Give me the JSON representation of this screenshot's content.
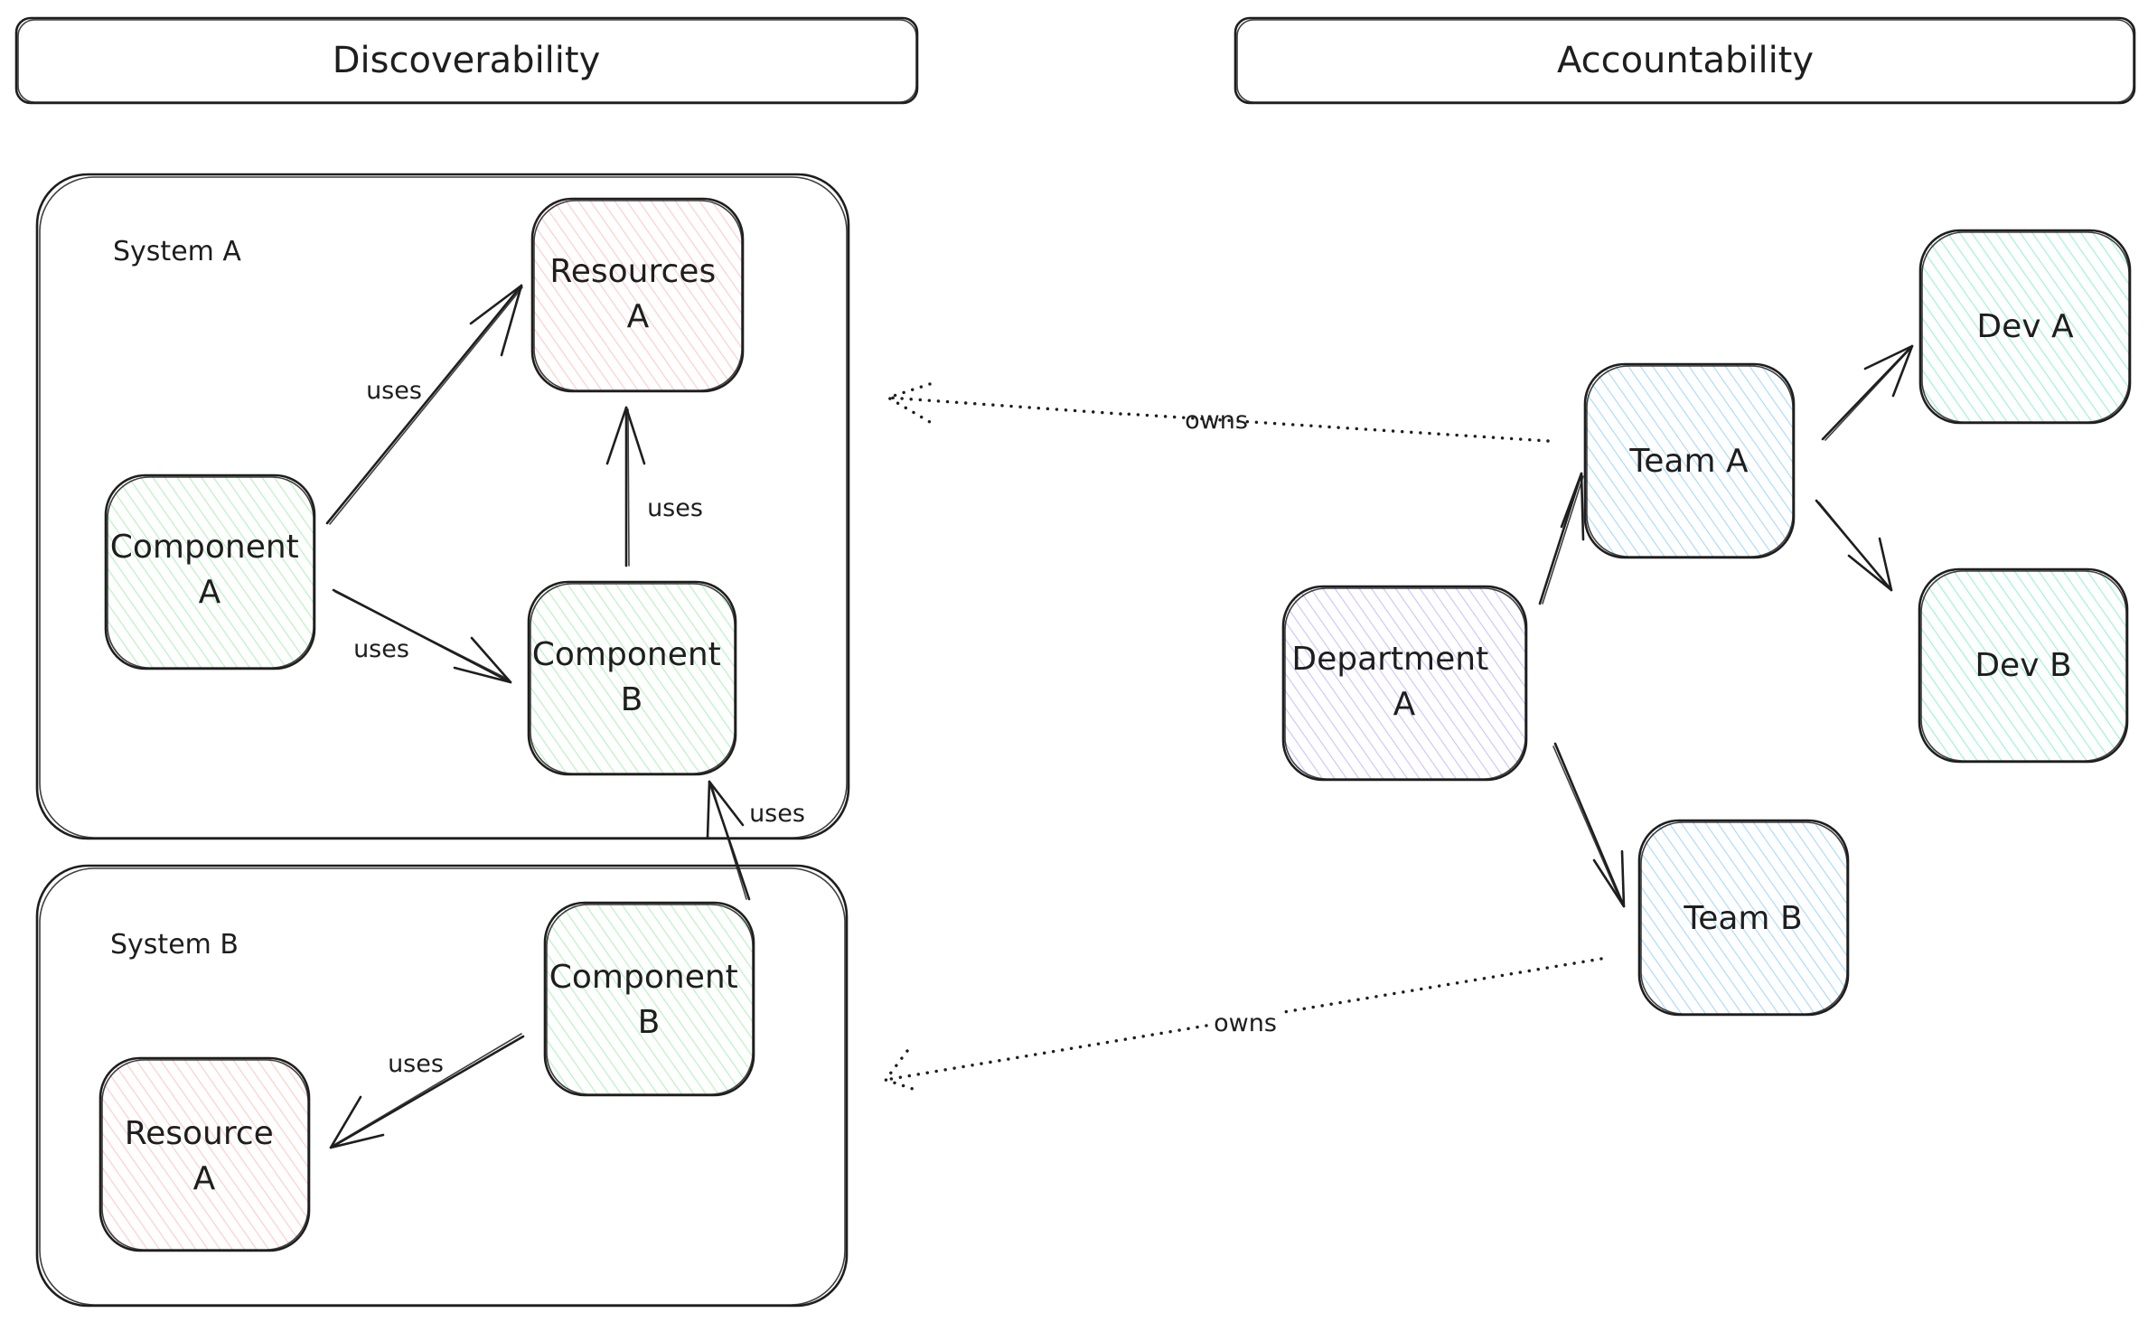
{
  "headers": {
    "left": "Discoverability",
    "right": "Accountability"
  },
  "colors": {
    "stroke": "#1e1e1e",
    "component_fill": "#b2f2bb",
    "resource_fill": "#ffc9c9",
    "department_fill": "#d0bfff",
    "team_fill": "#a5d8ff",
    "dev_fill": "#96f2d7"
  },
  "groups": [
    {
      "id": "system-a",
      "label": "System A"
    },
    {
      "id": "system-b",
      "label": "System B"
    }
  ],
  "nodes": [
    {
      "id": "resources-a",
      "group": "system-a",
      "kind": "resource",
      "lines": [
        "Resources",
        "A"
      ]
    },
    {
      "id": "component-a",
      "group": "system-a",
      "kind": "component",
      "lines": [
        "Component",
        "A"
      ]
    },
    {
      "id": "component-b-sys-a",
      "group": "system-a",
      "kind": "component",
      "lines": [
        "Component",
        "B"
      ]
    },
    {
      "id": "component-b-sys-b",
      "group": "system-b",
      "kind": "component",
      "lines": [
        "Component",
        "B"
      ]
    },
    {
      "id": "resource-a-sys-b",
      "group": "system-b",
      "kind": "resource",
      "lines": [
        "Resource",
        "A"
      ]
    },
    {
      "id": "department-a",
      "kind": "department",
      "lines": [
        "Department",
        "A"
      ]
    },
    {
      "id": "team-a",
      "kind": "team",
      "lines": [
        "Team A"
      ]
    },
    {
      "id": "team-b",
      "kind": "team",
      "lines": [
        "Team B"
      ]
    },
    {
      "id": "dev-a",
      "kind": "dev",
      "lines": [
        "Dev A"
      ]
    },
    {
      "id": "dev-b",
      "kind": "dev",
      "lines": [
        "Dev B"
      ]
    }
  ],
  "edges": [
    {
      "id": "compa-uses-resa",
      "from": "component-a",
      "to": "resources-a",
      "label": "uses",
      "style": "solid"
    },
    {
      "id": "compa-uses-compb",
      "from": "component-a",
      "to": "component-b-sys-a",
      "label": "uses",
      "style": "solid"
    },
    {
      "id": "compb-uses-resa",
      "from": "component-b-sys-a",
      "to": "resources-a",
      "label": "uses",
      "style": "solid"
    },
    {
      "id": "sysb-compb-uses-sysa-compb",
      "from": "component-b-sys-b",
      "to": "component-b-sys-a",
      "label": "uses",
      "style": "solid"
    },
    {
      "id": "sysb-compb-uses-resource",
      "from": "component-b-sys-b",
      "to": "resource-a-sys-b",
      "label": "uses",
      "style": "solid"
    },
    {
      "id": "teama-owns-sysa",
      "from": "team-a",
      "to": "system-a",
      "label": "owns",
      "style": "dotted"
    },
    {
      "id": "teamb-owns-sysb",
      "from": "team-b",
      "to": "system-b",
      "label": "owns",
      "style": "dotted"
    },
    {
      "id": "dept-teama",
      "from": "department-a",
      "to": "team-a",
      "label": "",
      "style": "solid"
    },
    {
      "id": "dept-teamb",
      "from": "department-a",
      "to": "team-b",
      "label": "",
      "style": "solid"
    },
    {
      "id": "teama-deva",
      "from": "team-a",
      "to": "dev-a",
      "label": "",
      "style": "solid"
    },
    {
      "id": "teama-devb",
      "from": "team-a",
      "to": "dev-b",
      "label": "",
      "style": "solid"
    }
  ]
}
